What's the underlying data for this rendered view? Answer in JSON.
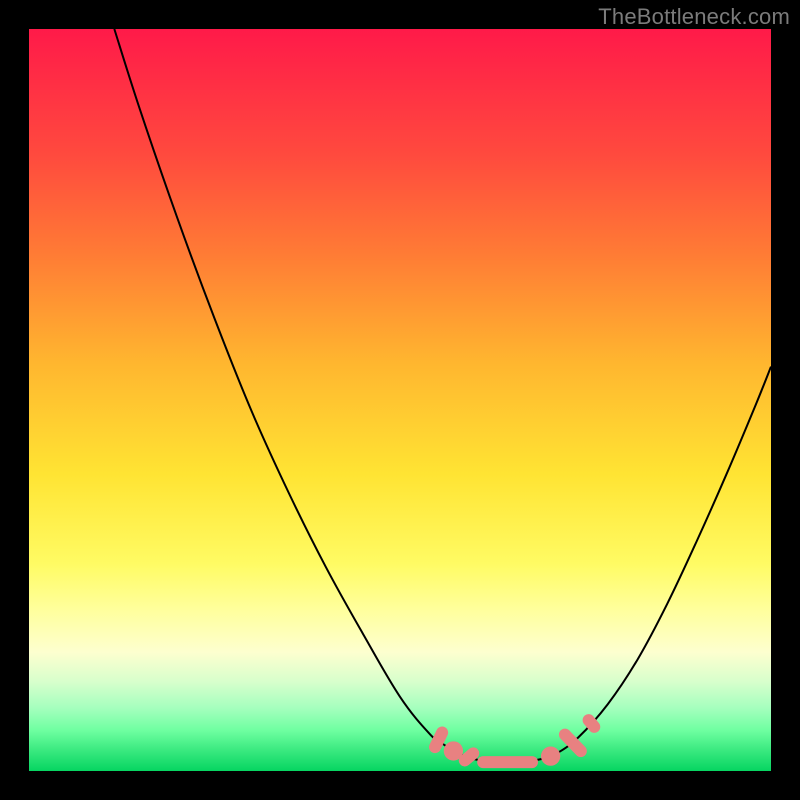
{
  "watermark": "TheBottleneck.com",
  "colors": {
    "frame": "#000000",
    "curve": "#000000",
    "marker_fill": "#e88181",
    "marker_stroke": "#c96868"
  },
  "chart_data": {
    "type": "line",
    "title": "",
    "xlabel": "",
    "ylabel": "",
    "xlim": [
      0,
      100
    ],
    "ylim": [
      0,
      100
    ],
    "series": [
      {
        "name": "left-branch",
        "x": [
          11.5,
          15,
          20,
          25,
          30,
          35,
          40,
          45,
          50,
          54,
          56,
          58
        ],
        "y": [
          100,
          89,
          74.5,
          61,
          48.5,
          37.5,
          27.5,
          18.5,
          10,
          5,
          3.5,
          2.3
        ]
      },
      {
        "name": "flat-bottom",
        "x": [
          58,
          60,
          63,
          66,
          69,
          71
        ],
        "y": [
          2.3,
          1.6,
          1.2,
          1.2,
          1.6,
          2.3
        ]
      },
      {
        "name": "right-branch",
        "x": [
          71,
          74,
          78,
          82,
          86,
          90,
          94,
          98,
          100
        ],
        "y": [
          2.3,
          4.5,
          9,
          15,
          22.5,
          31,
          40,
          49.5,
          54.5
        ]
      }
    ],
    "markers": [
      {
        "shape": "pill",
        "cx": 55.2,
        "cy": 4.2,
        "len": 3.8,
        "angle": -64
      },
      {
        "shape": "circle",
        "cx": 57.2,
        "cy": 2.7,
        "r": 1.3
      },
      {
        "shape": "pill",
        "cx": 59.3,
        "cy": 1.9,
        "len": 3.1,
        "angle": -40
      },
      {
        "shape": "pill",
        "cx": 64.5,
        "cy": 1.2,
        "len": 8.2,
        "angle": 0
      },
      {
        "shape": "circle",
        "cx": 70.3,
        "cy": 2.0,
        "r": 1.3
      },
      {
        "shape": "pill",
        "cx": 73.3,
        "cy": 3.8,
        "len": 4.7,
        "angle": 46
      },
      {
        "shape": "pill",
        "cx": 75.8,
        "cy": 6.4,
        "len": 2.8,
        "angle": 50
      }
    ]
  }
}
